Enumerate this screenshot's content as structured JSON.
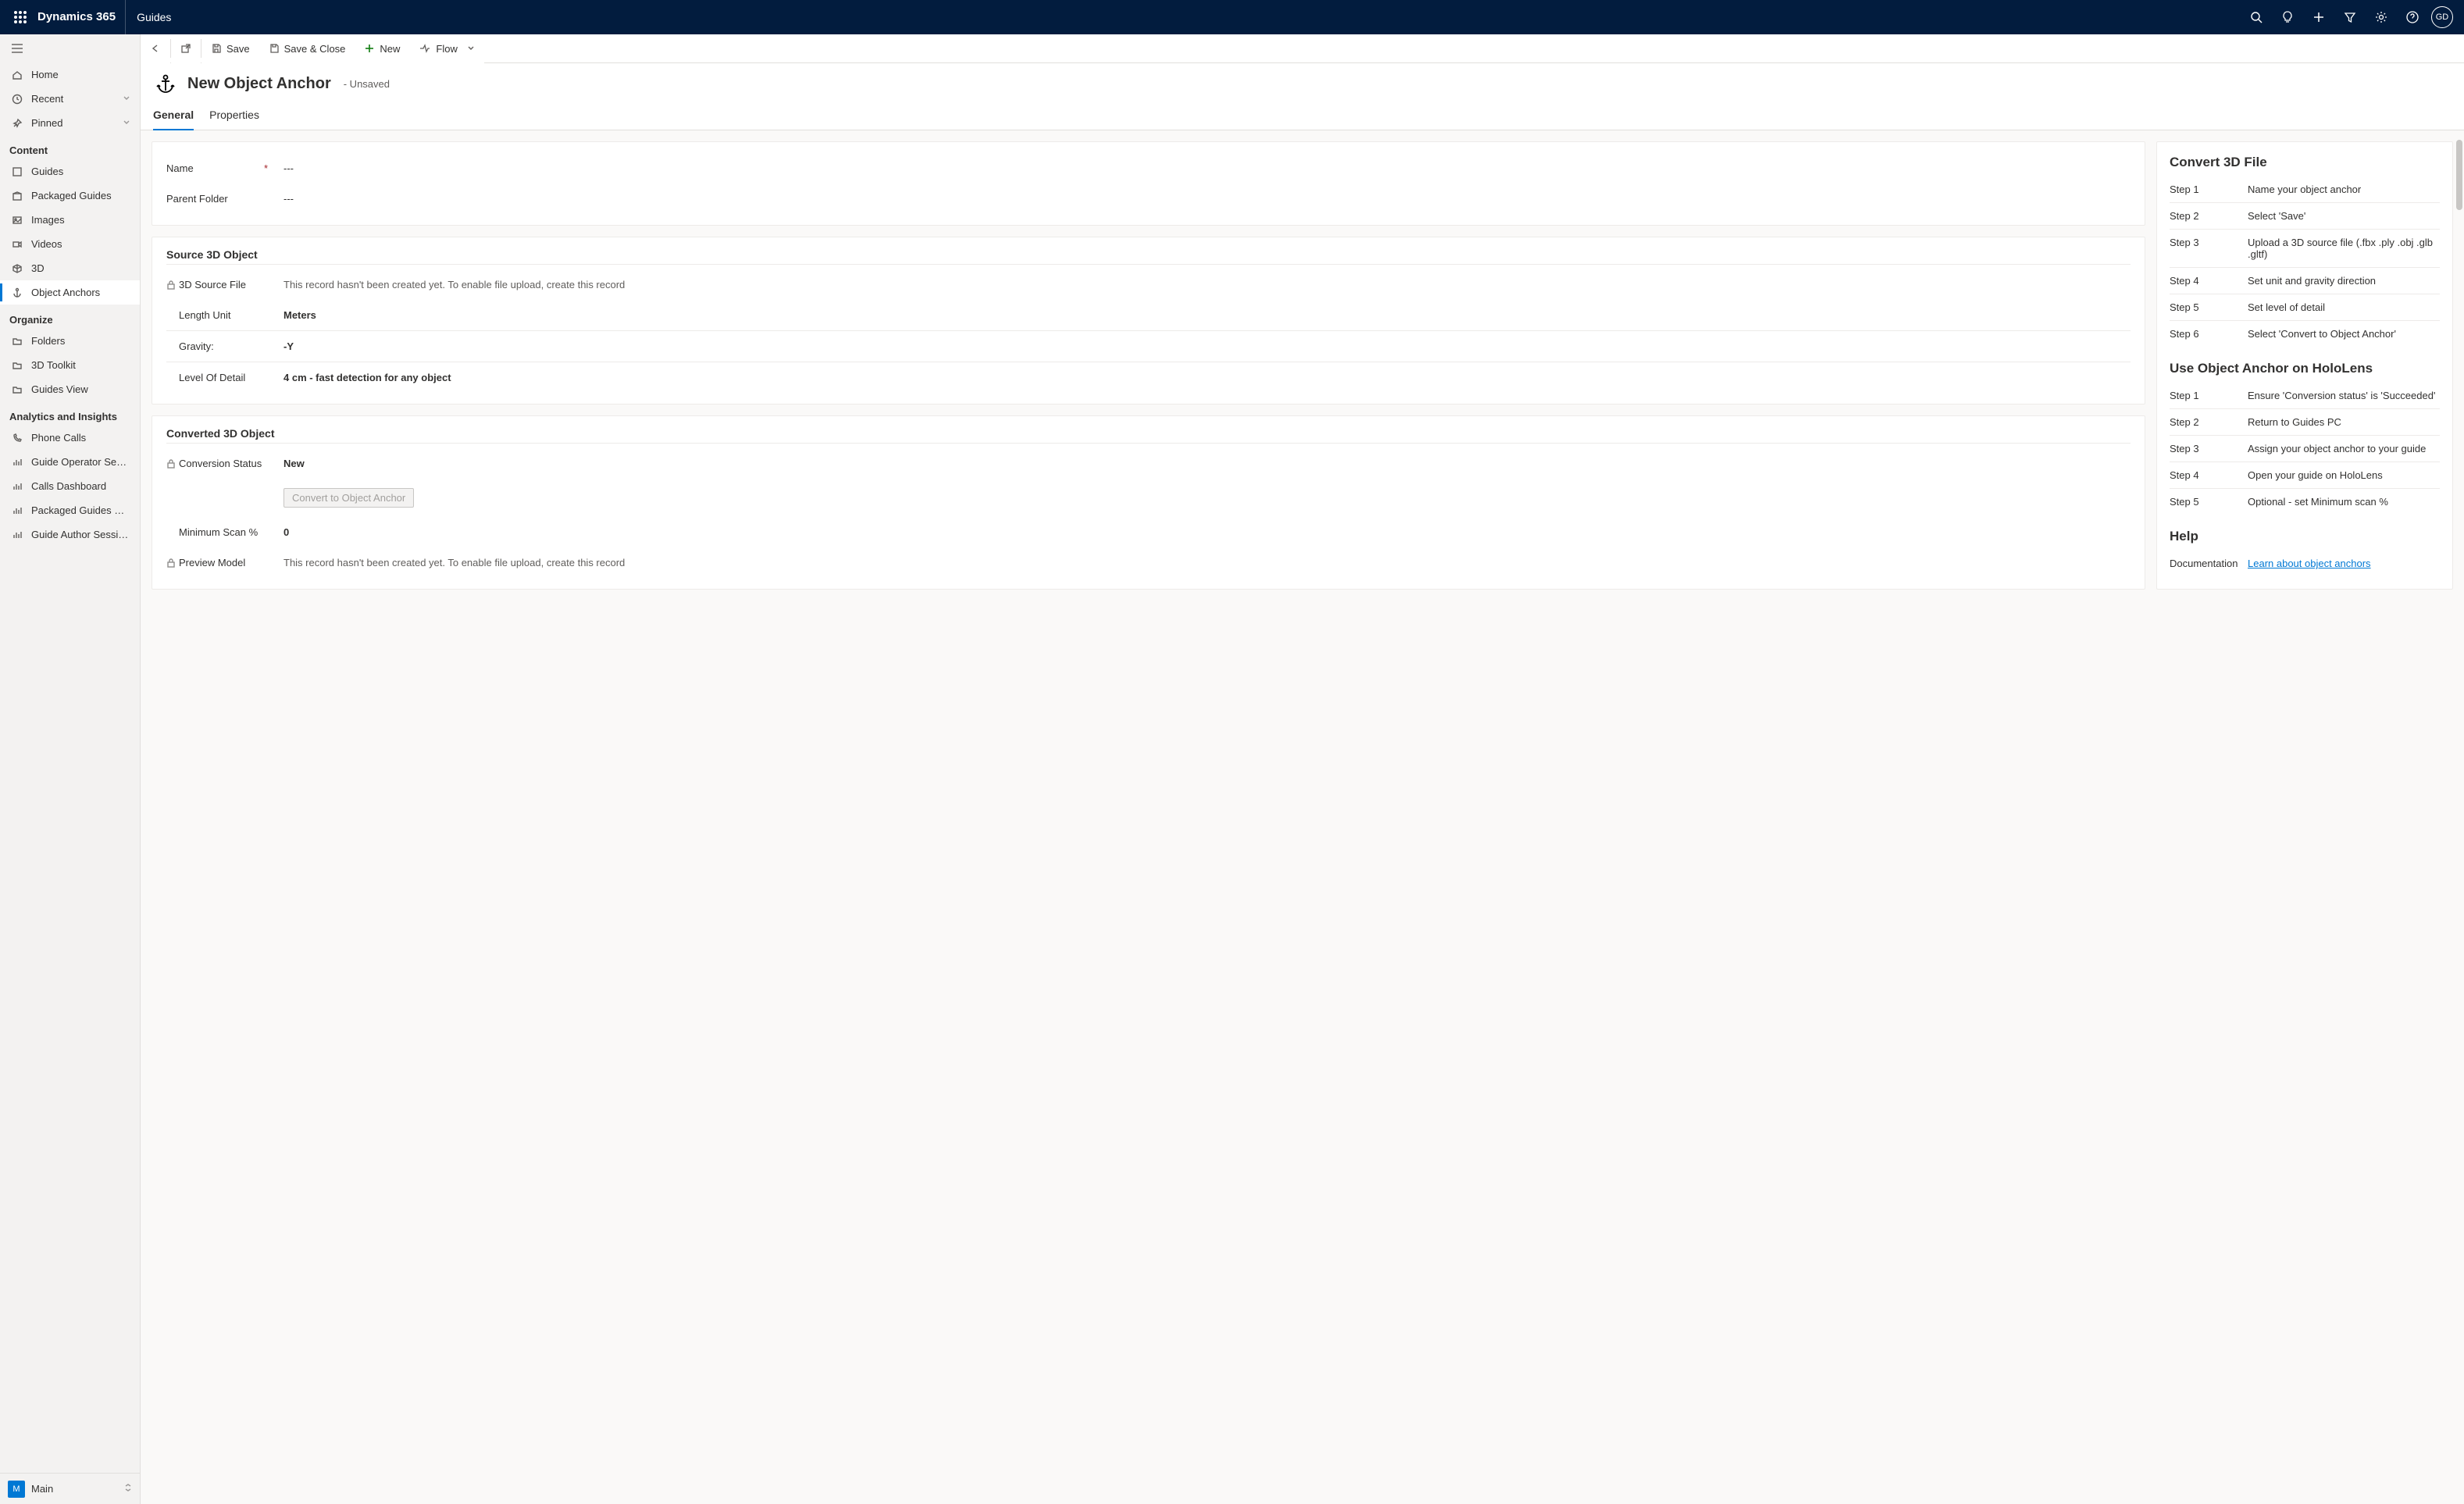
{
  "topbar": {
    "brand": "Dynamics 365",
    "app": "Guides",
    "avatar": "GD"
  },
  "nav": {
    "home": "Home",
    "recent": "Recent",
    "pinned": "Pinned",
    "group_content": "Content",
    "guides": "Guides",
    "packaged_guides": "Packaged Guides",
    "images": "Images",
    "videos": "Videos",
    "three_d": "3D",
    "object_anchors": "Object Anchors",
    "group_organize": "Organize",
    "folders": "Folders",
    "toolkit": "3D Toolkit",
    "guides_view": "Guides View",
    "group_analytics": "Analytics and Insights",
    "phone_calls": "Phone Calls",
    "op_sessions": "Guide Operator Sessi...",
    "calls_dash": "Calls Dashboard",
    "pkg_ops": "Packaged Guides Op...",
    "author_sessions": "Guide Author Sessions",
    "area_badge": "M",
    "area_name": "Main"
  },
  "cmd": {
    "save": "Save",
    "save_close": "Save & Close",
    "new": "New",
    "flow": "Flow"
  },
  "record": {
    "title": "New Object Anchor",
    "status": "- Unsaved"
  },
  "tabs": {
    "general": "General",
    "properties": "Properties"
  },
  "fields": {
    "name_label": "Name",
    "name_value": "---",
    "parent_label": "Parent Folder",
    "parent_value": "---",
    "source_section": "Source 3D Object",
    "src_file_label": "3D Source File",
    "src_file_value": "This record hasn't been created yet. To enable file upload, create this record",
    "length_label": "Length Unit",
    "length_value": "Meters",
    "gravity_label": "Gravity:",
    "gravity_value": "-Y",
    "lod_label": "Level Of Detail",
    "lod_value": "4 cm - fast detection for any object",
    "converted_section": "Converted 3D Object",
    "conv_status_label": "Conversion Status",
    "conv_status_value": "New",
    "convert_btn": "Convert to Object Anchor",
    "min_scan_label": "Minimum Scan %",
    "min_scan_value": "0",
    "preview_label": "Preview Model",
    "preview_value": "This record hasn't been created yet. To enable file upload, create this record"
  },
  "help": {
    "h_convert": "Convert 3D File",
    "convert_steps": [
      {
        "k": "Step 1",
        "v": "Name your object anchor"
      },
      {
        "k": "Step 2",
        "v": "Select 'Save'"
      },
      {
        "k": "Step 3",
        "v": "Upload a 3D source file (.fbx .ply .obj .glb .gltf)"
      },
      {
        "k": "Step 4",
        "v": "Set unit and gravity direction"
      },
      {
        "k": "Step 5",
        "v": "Set level of detail"
      },
      {
        "k": "Step 6",
        "v": "Select 'Convert to Object Anchor'"
      }
    ],
    "h_use": "Use Object Anchor on HoloLens",
    "use_steps": [
      {
        "k": "Step 1",
        "v": "Ensure 'Conversion status' is 'Succeeded'"
      },
      {
        "k": "Step 2",
        "v": "Return to Guides PC"
      },
      {
        "k": "Step 3",
        "v": "Assign your object anchor to your guide"
      },
      {
        "k": "Step 4",
        "v": "Open your guide on HoloLens"
      },
      {
        "k": "Step 5",
        "v": "Optional - set Minimum scan %"
      }
    ],
    "h_help": "Help",
    "doc_label": "Documentation",
    "doc_link": "Learn about object anchors"
  }
}
